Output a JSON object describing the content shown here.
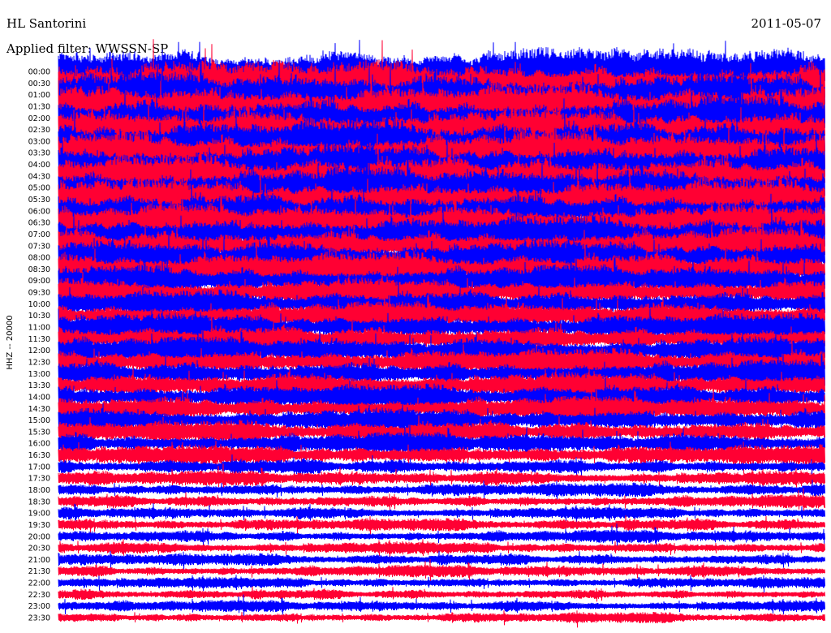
{
  "header": {
    "station": "HL Santorini",
    "date": "2011-05-07",
    "filter": "Applied filter: WWSSN-SP"
  },
  "chart_data": {
    "type": "line",
    "ylabel": "HHZ -- 20000",
    "row_labels": [
      "00:00",
      "00:30",
      "01:00",
      "01:30",
      "02:00",
      "02:30",
      "03:00",
      "03:30",
      "04:00",
      "04:30",
      "05:00",
      "05:30",
      "06:00",
      "06:30",
      "07:00",
      "07:30",
      "08:00",
      "08:30",
      "09:00",
      "09:30",
      "10:00",
      "10:30",
      "11:00",
      "11:30",
      "12:00",
      "12:30",
      "13:00",
      "13:30",
      "14:00",
      "14:30",
      "15:00",
      "15:30",
      "16:00",
      "16:30",
      "17:00",
      "17:30",
      "18:00",
      "18:30",
      "19:00",
      "19:30",
      "20:00",
      "20:30",
      "21:00",
      "21:30",
      "22:00",
      "22:30",
      "23:00",
      "23:30"
    ],
    "amplitude_profile": [
      1.55,
      1.5,
      1.5,
      1.5,
      1.48,
      1.46,
      1.45,
      1.44,
      1.42,
      1.42,
      1.38,
      1.35,
      1.3,
      1.25,
      1.22,
      1.2,
      1.18,
      1.15,
      1.05,
      0.95,
      0.92,
      0.92,
      0.92,
      0.92,
      0.9,
      0.9,
      0.9,
      0.88,
      0.85,
      0.82,
      0.8,
      0.75,
      0.72,
      0.68,
      0.55,
      0.48,
      0.46,
      0.44,
      0.42,
      0.42,
      0.42,
      0.42,
      0.4,
      0.4,
      0.38,
      0.36,
      0.38,
      0.36
    ],
    "colors": [
      "#0000ff",
      "#ff0033"
    ],
    "grid": false,
    "legend": "none"
  }
}
